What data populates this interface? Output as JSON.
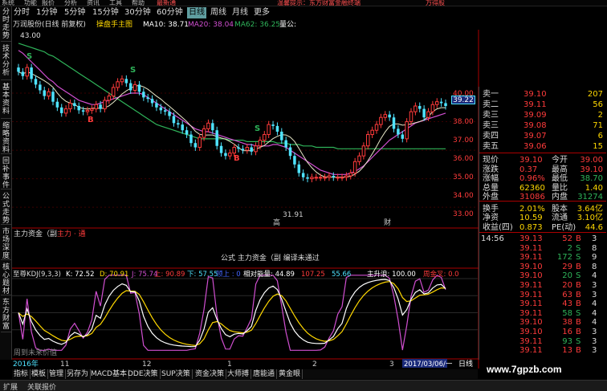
{
  "topbar": {
    "items": [
      "系统",
      "功能",
      "报价",
      "分析",
      "资讯",
      "工具",
      "帮助",
      "最新通",
      "温馨提示：东方财富金融终端",
      "万得股"
    ]
  },
  "sidebar": {
    "items": [
      "分时走势",
      "技术分析",
      "基本资料",
      "缩略资料",
      "回补事件",
      "公式走势",
      "市场深度",
      "核心题材",
      "东方财富"
    ]
  },
  "period_tabs": {
    "items": [
      "分时",
      "1分钟",
      "5分钟",
      "15分钟",
      "30分钟",
      "60分钟",
      "日线",
      "周线",
      "月线",
      "更多"
    ],
    "active": 6
  },
  "ma_line": {
    "title": "万润股份(日线 前复权)",
    "indicator": "操盘手主图",
    "ma10": "MA10: 38.71",
    "ma20": "MA20: 38.04",
    "ma62": "MA62: 36.25",
    "ma60": "量公:"
  },
  "chart": {
    "price_ticks": [
      "40.00",
      "39.22",
      "38.00",
      "37.00",
      "36.00",
      "35.00",
      "34.00",
      "33.00",
      "32.00"
    ],
    "current_price_label": "39.22",
    "low_label": "31.91",
    "high_label": "43.00",
    "signals": {
      "S": "S",
      "B": "B"
    },
    "zhuli_label": "主力资金（副",
    "zhuli_tag": "主力 · 通",
    "formula_msg": "公式 主力资金（副 编译未通过",
    "kdj": {
      "name": "至尊KDJ(9,3,3)",
      "k": "K: 72.52",
      "d": "D: 70.91",
      "j": "J: 75.74",
      "up": "上: 90.89",
      "down": "下: 57.55",
      "lead": "领上 : 0",
      "energy": "相对能量: 44.89",
      "v1": "107.25",
      "v2": "55.66",
      "rise": "主升浪: 100.00",
      "gold": "周金叉: 0.0"
    },
    "kdj_ticks": [
      "100",
      "75",
      "50",
      "25"
    ],
    "kdj_note": "周到未来价值",
    "date_left": "2016年",
    "m11": "11",
    "m12": "12",
    "m1": "1",
    "m2": "2",
    "m3": "3",
    "date_right": "2017/03/06/一",
    "dayline": "日线",
    "gao": "高",
    "cai": "财",
    "series": {
      "closes": [
        41.5,
        41.2,
        41.8,
        41.0,
        40.6,
        40.2,
        39.8,
        40.1,
        39.4,
        39.0,
        38.6,
        38.9,
        39.3,
        39.1,
        38.8,
        38.7,
        38.8,
        38.9,
        39.2,
        38.9,
        39.5,
        39.8,
        40.4,
        40.8,
        41.0,
        40.7,
        40.2,
        40.6,
        40.1,
        39.7,
        39.6,
        39.3,
        39.0,
        38.8,
        38.7,
        38.4,
        37.9,
        37.8,
        37.4,
        37.1,
        36.5,
        36.2,
        36.9,
        37.5,
        37.9,
        37.4,
        36.3,
        35.8,
        35.6,
        35.8,
        36.2,
        36.1,
        36.0,
        36.2,
        35.9,
        36.3,
        36.7,
        37.1,
        37.8,
        37.7,
        37.3,
        36.7,
        36.2,
        35.6,
        35.0,
        34.4,
        34.1,
        34.0,
        34.1,
        34.1,
        34.1,
        34.1,
        34.2,
        34.1,
        34.1,
        34.1,
        34.2,
        34.4,
        35.2,
        35.6,
        36.3,
        37.1,
        37.4,
        37.8,
        38.3,
        38.5,
        38.3,
        37.5,
        37.1,
        36.8,
        38.0,
        38.7,
        39.1,
        38.9,
        38.3,
        38.7,
        39.2,
        39.4,
        39.3,
        39.1
      ],
      "ma20": [
        43.0,
        42.8,
        42.5,
        42.2,
        41.9,
        41.6,
        41.3,
        41.0,
        40.8,
        40.5,
        40.3,
        40.1,
        39.9,
        39.7,
        39.5,
        39.4,
        39.3,
        39.2,
        39.2,
        39.3,
        39.4,
        39.5,
        39.6,
        39.7,
        39.8,
        39.9,
        40.0,
        40.0,
        40.0,
        39.9,
        39.7,
        39.5,
        39.3,
        39.1,
        38.9,
        38.7,
        38.5,
        38.3,
        38.1,
        37.9,
        37.7,
        37.5,
        37.4,
        37.3,
        37.3,
        37.2,
        37.1,
        37.0,
        36.9,
        36.8,
        36.7,
        36.6,
        36.5,
        36.4,
        36.4,
        36.3,
        36.3,
        36.3,
        36.3,
        36.4,
        36.4,
        36.3,
        36.2,
        36.0,
        35.8,
        35.6,
        35.4,
        35.2,
        35.0,
        34.8,
        34.6,
        34.5,
        34.4,
        34.3,
        34.3,
        34.3,
        34.3,
        34.4,
        34.5,
        34.7,
        34.9,
        35.2,
        35.5,
        35.8,
        36.1,
        36.4,
        36.7,
        36.9,
        37.1,
        37.3,
        37.5,
        37.7,
        37.9,
        38.0,
        38.1,
        38.2,
        38.3,
        38.4,
        38.5,
        38.6
      ],
      "ma60": [
        43.5,
        43.4,
        43.3,
        43.2,
        43.1,
        43.0,
        42.9,
        42.7,
        42.6,
        42.4,
        42.2,
        42.0,
        41.8,
        41.6,
        41.4,
        41.2,
        41.0,
        40.8,
        40.6,
        40.4,
        40.2,
        40.0,
        39.8,
        39.6,
        39.4,
        39.2,
        39.0,
        38.8,
        38.6,
        38.4,
        38.2,
        38.0,
        37.8,
        37.7,
        37.6,
        37.5,
        37.4,
        37.3,
        37.2,
        37.1,
        37.0,
        36.9,
        36.8,
        36.8,
        36.8,
        36.8,
        36.8,
        36.8,
        36.8,
        36.7,
        36.7,
        36.7,
        36.7,
        36.6,
        36.6,
        36.6,
        36.6,
        36.6,
        36.6,
        36.6,
        36.5,
        36.5,
        36.5,
        36.4,
        36.4,
        36.4,
        36.3,
        36.3,
        36.3,
        36.2,
        36.2,
        36.2,
        36.2,
        36.2,
        36.1,
        36.1,
        36.1,
        36.1,
        36.1,
        36.1,
        36.1,
        36.1,
        36.1,
        36.1,
        36.1,
        36.1,
        36.1,
        36.1,
        36.1,
        36.1,
        36.1,
        36.1,
        36.1,
        36.1,
        36.1,
        36.1,
        36.1,
        36.1,
        36.1,
        36.1
      ]
    }
  },
  "quote": {
    "sell": [
      [
        "卖二",
        "39.11",
        "56"
      ],
      [
        "卖三",
        "39.09",
        "2"
      ],
      [
        "卖三",
        "39.08",
        "71"
      ],
      [
        "卖四",
        "39.07",
        "6"
      ],
      [
        "卖五",
        "39.06",
        "15"
      ]
    ],
    "sell_top": [
      "卖一",
      "39.10",
      "207"
    ],
    "rows": [
      [
        "现价",
        "39.10",
        "今开",
        "39.00"
      ],
      [
        "涨跌",
        "0.37",
        "最高",
        "39.10"
      ],
      [
        "涨幅",
        "0.96%",
        "最低",
        "38.70"
      ],
      [
        "总量",
        "62360",
        "量比",
        "1.40"
      ],
      [
        "外盘",
        "31086",
        "内盘",
        "31274"
      ],
      [
        "换手",
        "2.01%",
        "股本",
        "3.64亿"
      ],
      [
        "净资",
        "10.59",
        "流通",
        "3.10亿"
      ],
      [
        "收益(四)",
        "0.873",
        "PE(动)",
        "44.6"
      ]
    ],
    "ticks": [
      [
        "14:56",
        "39.13",
        "52",
        "B",
        "3"
      ],
      [
        "",
        "39.11",
        "2",
        "S",
        "8"
      ],
      [
        "",
        "39.11",
        "172",
        "S",
        "9"
      ],
      [
        "",
        "39.10",
        "29",
        "B",
        "8"
      ],
      [
        "",
        "39.10",
        "20",
        "S",
        "4"
      ],
      [
        "",
        "39.11",
        "20",
        "B",
        "3"
      ],
      [
        "",
        "39.11",
        "63",
        "B",
        "3"
      ],
      [
        "",
        "39.11",
        "43",
        "B",
        "4"
      ],
      [
        "",
        "39.11",
        "58",
        "S",
        "4"
      ],
      [
        "",
        "39.10",
        "38",
        "B",
        "4"
      ],
      [
        "",
        "39.10",
        "16",
        "B",
        "3"
      ],
      [
        "",
        "39.11",
        "93",
        "S",
        "3"
      ],
      [
        "",
        "39.11",
        "13",
        "B",
        "3"
      ]
    ]
  },
  "bottom_tabs": {
    "items": [
      "指标",
      "模板",
      "管理",
      "另存为",
      "MACD基本",
      "DDE决策",
      "SUP决策",
      "资金决策",
      "大师搏",
      "唐能通",
      "黄金眼"
    ]
  },
  "status": {
    "items": [
      "扩展",
      "关联报价"
    ]
  },
  "watermark": "www.7gpzb.com",
  "colors": {
    "up": "#ff3b3b",
    "down": "#4fe3ff",
    "ma10": "#ffffff",
    "ma20": "#d14fd1",
    "ma60": "#2fb45a",
    "gold": "#ffd800"
  }
}
